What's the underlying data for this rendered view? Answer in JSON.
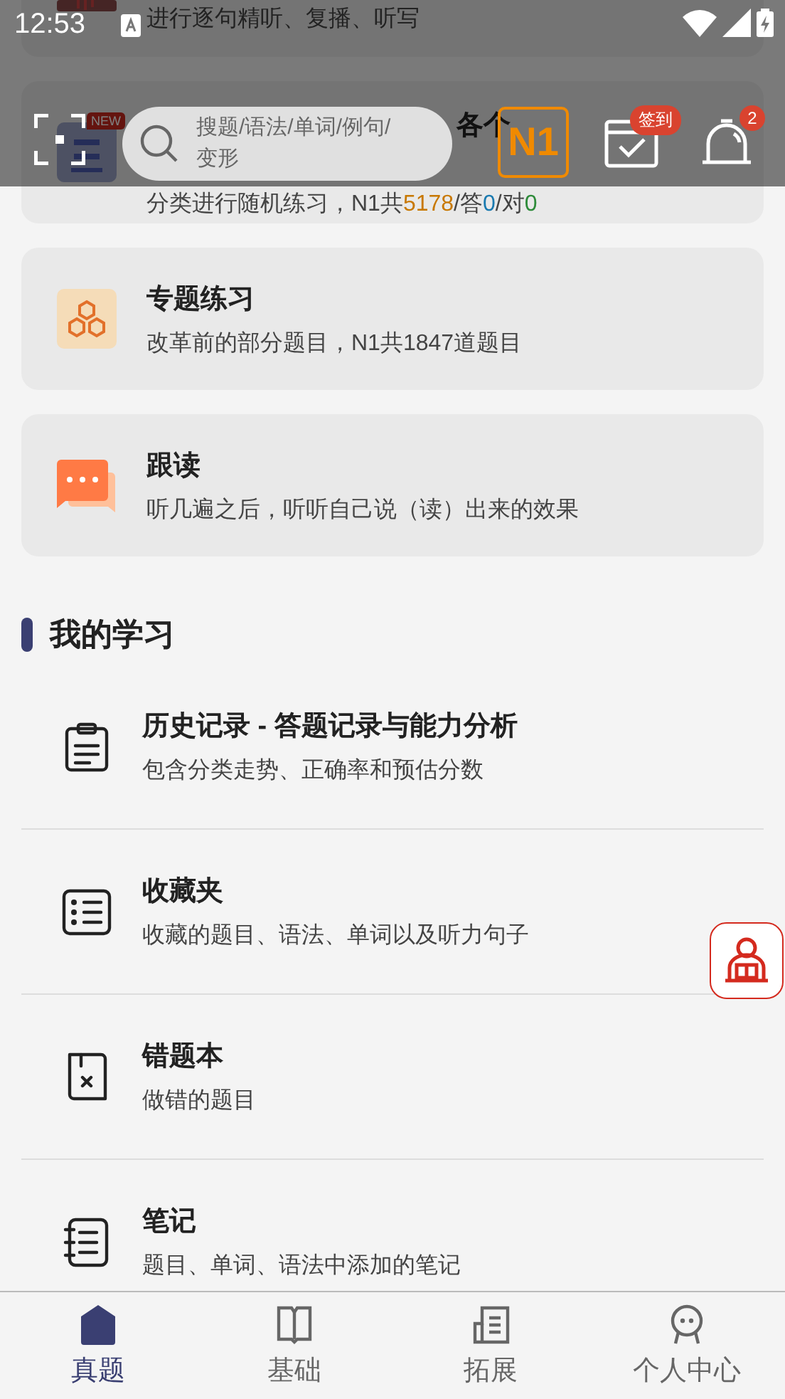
{
  "status_bar": {
    "time": "12:53"
  },
  "header": {
    "search_placeholder": "搜题/语法/单词/例句/变形",
    "level": "N1",
    "checkin_badge": "签到",
    "notification_count": "2"
  },
  "feature_cards": [
    {
      "kind": "listen",
      "subtitle": "进行逐句精听、复播、听写"
    },
    {
      "kind": "real",
      "badge": "NEW",
      "title": "各个",
      "subtitle": "分类进行随机练习，N1共",
      "total": "5178",
      "answered_label": "/答",
      "answered": "0",
      "correct_label": "/对",
      "correct": "0"
    },
    {
      "kind": "topic",
      "title": "专题练习",
      "subtitle": "改革前的部分题目，N1共1847道题目"
    },
    {
      "kind": "shadow",
      "title": "跟读",
      "subtitle": "听几遍之后，听听自己说（读）出来的效果"
    }
  ],
  "section_title": "我的学习",
  "study_items": [
    {
      "kind": "history",
      "title": "历史记录 - 答题记录与能力分析",
      "subtitle": "包含分类走势、正确率和预估分数"
    },
    {
      "kind": "favorites",
      "title": "收藏夹",
      "subtitle": "收藏的题目、语法、单词以及听力句子"
    },
    {
      "kind": "mistakes",
      "title": "错题本",
      "subtitle": "做错的题目"
    },
    {
      "kind": "notes",
      "title": "笔记",
      "subtitle": "题目、单词、语法中添加的笔记"
    }
  ],
  "tab_bar": [
    {
      "kind": "home",
      "label": "真题",
      "selected": true
    },
    {
      "kind": "book",
      "label": "基础",
      "selected": false
    },
    {
      "kind": "news",
      "label": "拓展",
      "selected": false
    },
    {
      "kind": "person",
      "label": "个人中心",
      "selected": false
    }
  ]
}
